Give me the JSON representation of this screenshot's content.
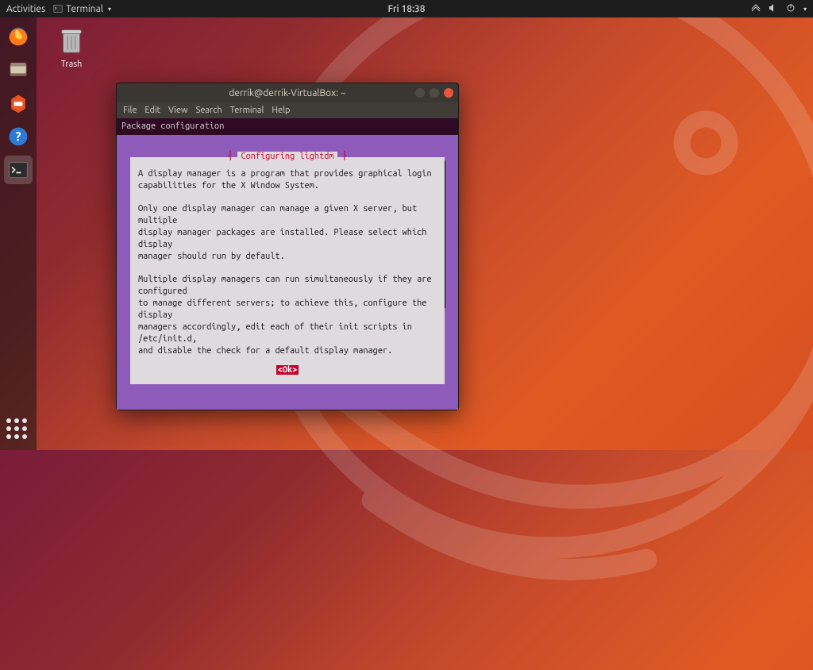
{
  "top_panel": {
    "activities": "Activities",
    "active_app": "Terminal",
    "clock": "Fri 18:38"
  },
  "desktop": {
    "trash_label": "Trash"
  },
  "dock": {
    "items": [
      {
        "name": "firefox",
        "label": "Firefox"
      },
      {
        "name": "files",
        "label": "Files"
      },
      {
        "name": "software",
        "label": "Software"
      },
      {
        "name": "help",
        "label": "Help"
      },
      {
        "name": "terminal",
        "label": "Terminal"
      }
    ]
  },
  "window": {
    "title": "derrik@derrik-VirtualBox: ~",
    "menus": [
      "File",
      "Edit",
      "View",
      "Search",
      "Terminal",
      "Help"
    ]
  },
  "terminal": {
    "heading": "Package configuration",
    "dialog_title": "Configuring lightdm",
    "dialog_text": "A display manager is a program that provides graphical login\ncapabilities for the X Window System.\n\nOnly one display manager can manage a given X server, but multiple\ndisplay manager packages are installed. Please select which display\nmanager should run by default.\n\nMultiple display managers can run simultaneously if they are configured\nto manage different servers; to achieve this, configure the display\nmanagers accordingly, edit each of their init scripts in /etc/init.d,\nand disable the check for a default display manager.",
    "ok_label": "<Ok>"
  }
}
